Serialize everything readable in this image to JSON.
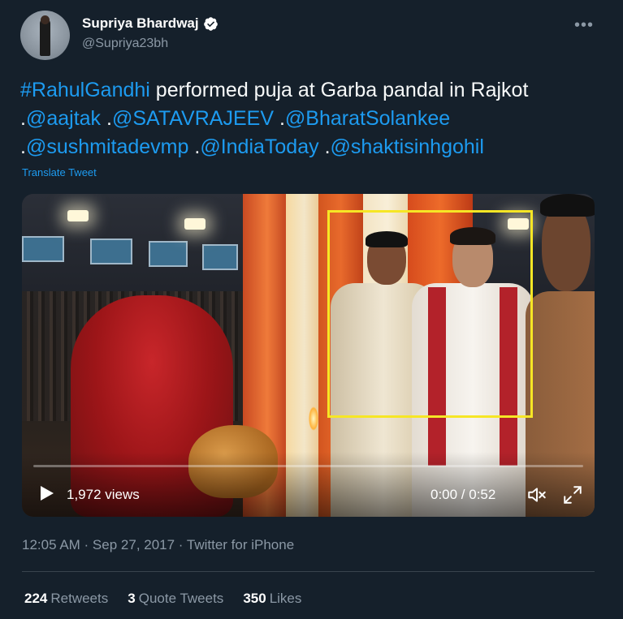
{
  "author": {
    "name": "Supriya Bhardwaj",
    "handle": "@Supriya23bh",
    "verified_icon": "verified-badge-icon"
  },
  "more_icon": "more-options-icon",
  "tweet": {
    "segments": [
      {
        "text": "#RahulGandhi",
        "link": true
      },
      {
        "text": " performed puja at Garba pandal in Rajkot .",
        "link": false
      },
      {
        "text": "@aajtak",
        "link": true
      },
      {
        "text": " .",
        "link": false
      },
      {
        "text": "@SATAVRAJEEV",
        "link": true
      },
      {
        "text": " .",
        "link": false
      },
      {
        "text": "@BharatSolankee",
        "link": true
      },
      {
        "text": " .",
        "link": false
      },
      {
        "text": "@sushmitadevmp",
        "link": true
      },
      {
        "text": " .",
        "link": false
      },
      {
        "text": "@IndiaToday",
        "link": true
      },
      {
        "text": " .",
        "link": false
      },
      {
        "text": "@shaktisinhgohil",
        "link": true
      }
    ],
    "translate_label": "Translate Tweet"
  },
  "video": {
    "views": "1,972 views",
    "time": "0:00 / 0:52",
    "progress": 0.0,
    "play_icon": "play-icon",
    "volume_icon": "volume-icon",
    "fullscreen_icon": "fullscreen-icon"
  },
  "meta": {
    "text": "12:05 AM · Sep 27, 2017 · Twitter for iPhone"
  },
  "stats": {
    "retweets_num": "224",
    "retweets_label": "Retweets",
    "quotes_num": "3",
    "quotes_label": "Quote Tweets",
    "likes_num": "350",
    "likes_label": "Likes"
  },
  "colors": {
    "background": "#15202b",
    "link": "#1d9bf0",
    "muted": "#8b98a5",
    "highlight_box": "#f6e625"
  }
}
